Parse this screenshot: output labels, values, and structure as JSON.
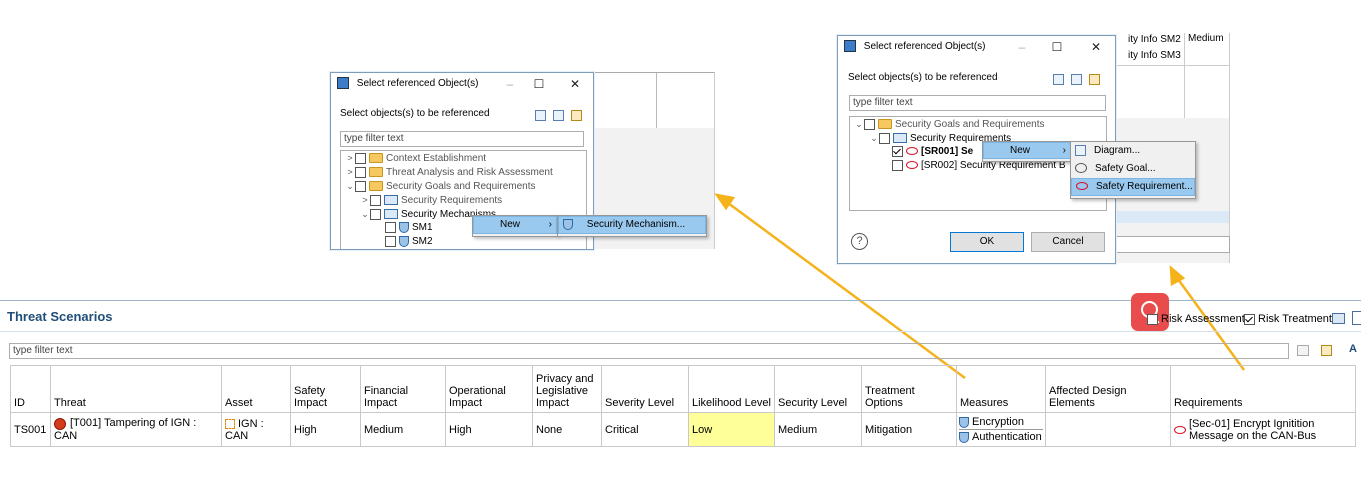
{
  "dialog_left": {
    "title": "Select referenced Object(s)",
    "prompt": "Select objects(s) to be referenced",
    "filter_placeholder": "type filter text",
    "tree": [
      {
        "label": "Context Establishment"
      },
      {
        "label": "Threat Analysis and Risk Assessment"
      },
      {
        "label": "Security Goals and Requirements"
      },
      {
        "label": "Security Requirements"
      },
      {
        "label": "Security Mechanisms"
      },
      {
        "label": "SM1"
      },
      {
        "label": "SM2"
      }
    ],
    "context_menu": {
      "new": "New",
      "sub_item": "Security Mechanism..."
    }
  },
  "dialog_right": {
    "title": "Select referenced Object(s)",
    "prompt": "Select objects(s) to be referenced",
    "filter_placeholder": "type filter text",
    "tree": [
      {
        "label": "Security Goals and Requirements"
      },
      {
        "label": "Security Requirements"
      },
      {
        "label": "[SR001] Se"
      },
      {
        "label": "[SR002] Security Requirement B"
      }
    ],
    "context_menu": {
      "new": "New",
      "items": [
        "Diagram...",
        "Safety Goal...",
        "Safety Requirement..."
      ]
    },
    "ok": "OK",
    "cancel": "Cancel",
    "bg_cells": [
      "ity Info SM2",
      "ity Info SM3",
      "Medium"
    ]
  },
  "panel": {
    "title": "Threat Scenarios",
    "filter_placeholder": "type filter text",
    "checkbox_risk_assessment": "Risk Assessment",
    "checkbox_risk_treatment": "Risk Treatment",
    "font_button": "A"
  },
  "table": {
    "headers": [
      "ID",
      "Threat",
      "Asset",
      "Safety Impact",
      "Financial Impact",
      "Operational Impact",
      "Privacy and Legislative Impact",
      "Severity Level",
      "Likelihood Level",
      "Security Level",
      "Treatment Options",
      "Measures",
      "Affected Design Elements",
      "Requirements"
    ],
    "rows": [
      {
        "id": "TS001",
        "threat": "[T001] Tampering of IGN : CAN",
        "asset": "IGN : CAN",
        "safety_impact": "High",
        "financial_impact": "Medium",
        "operational_impact": "High",
        "privacy_impact": "None",
        "severity": "Critical",
        "likelihood": "Low",
        "security_level": "Medium",
        "treatment": "Mitigation",
        "measures": [
          "Encryption",
          "Authentication"
        ],
        "affected": "",
        "requirements": "[Sec-01] Encrypt Ignitition Message on the CAN-Bus"
      }
    ]
  },
  "colors": {
    "accent": "#1f4e79",
    "highlight": "#ffff99",
    "arrow": "#f5b21b",
    "search_badge": "#e84c4c"
  }
}
